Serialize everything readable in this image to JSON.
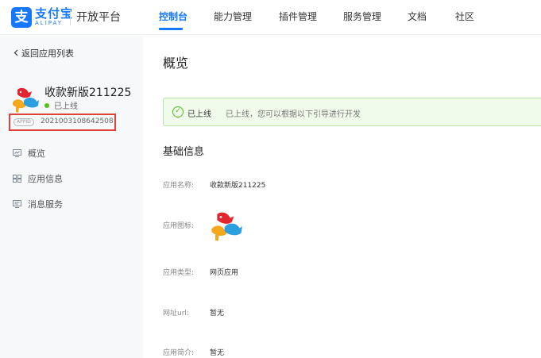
{
  "header": {
    "logo_glyph": "支",
    "brand_cn": "支付宝",
    "brand_en": "ALIPAY",
    "platform": "开放平台",
    "nav": [
      "控制台",
      "能力管理",
      "插件管理",
      "服务管理",
      "文档",
      "社区"
    ],
    "active_nav": "控制台"
  },
  "sidebar": {
    "back": "返回应用列表",
    "app_name": "收款新版211225",
    "status": "已上线",
    "appid_tag": "APPID",
    "appid": "2021003108642508",
    "menu": [
      {
        "label": "概览",
        "icon": "overview-icon"
      },
      {
        "label": "应用信息",
        "icon": "grid-icon"
      },
      {
        "label": "消息服务",
        "icon": "message-icon"
      }
    ]
  },
  "main": {
    "title": "概览",
    "banner": {
      "title": "已上线",
      "desc": "已上线，您可以根据以下引导进行开发"
    },
    "section": "基础信息",
    "fields": {
      "name_label": "应用名称:",
      "name_value": "收款新版211225",
      "icon_label": "应用图标:",
      "type_label": "应用类型:",
      "type_value": "网页应用",
      "url_label": "网址url:",
      "url_value": "暂无",
      "intro_label": "应用简介:",
      "intro_value": "暂无"
    }
  },
  "colors": {
    "accent": "#1677ff",
    "success": "#52c41a",
    "highlight": "#e0413b"
  }
}
